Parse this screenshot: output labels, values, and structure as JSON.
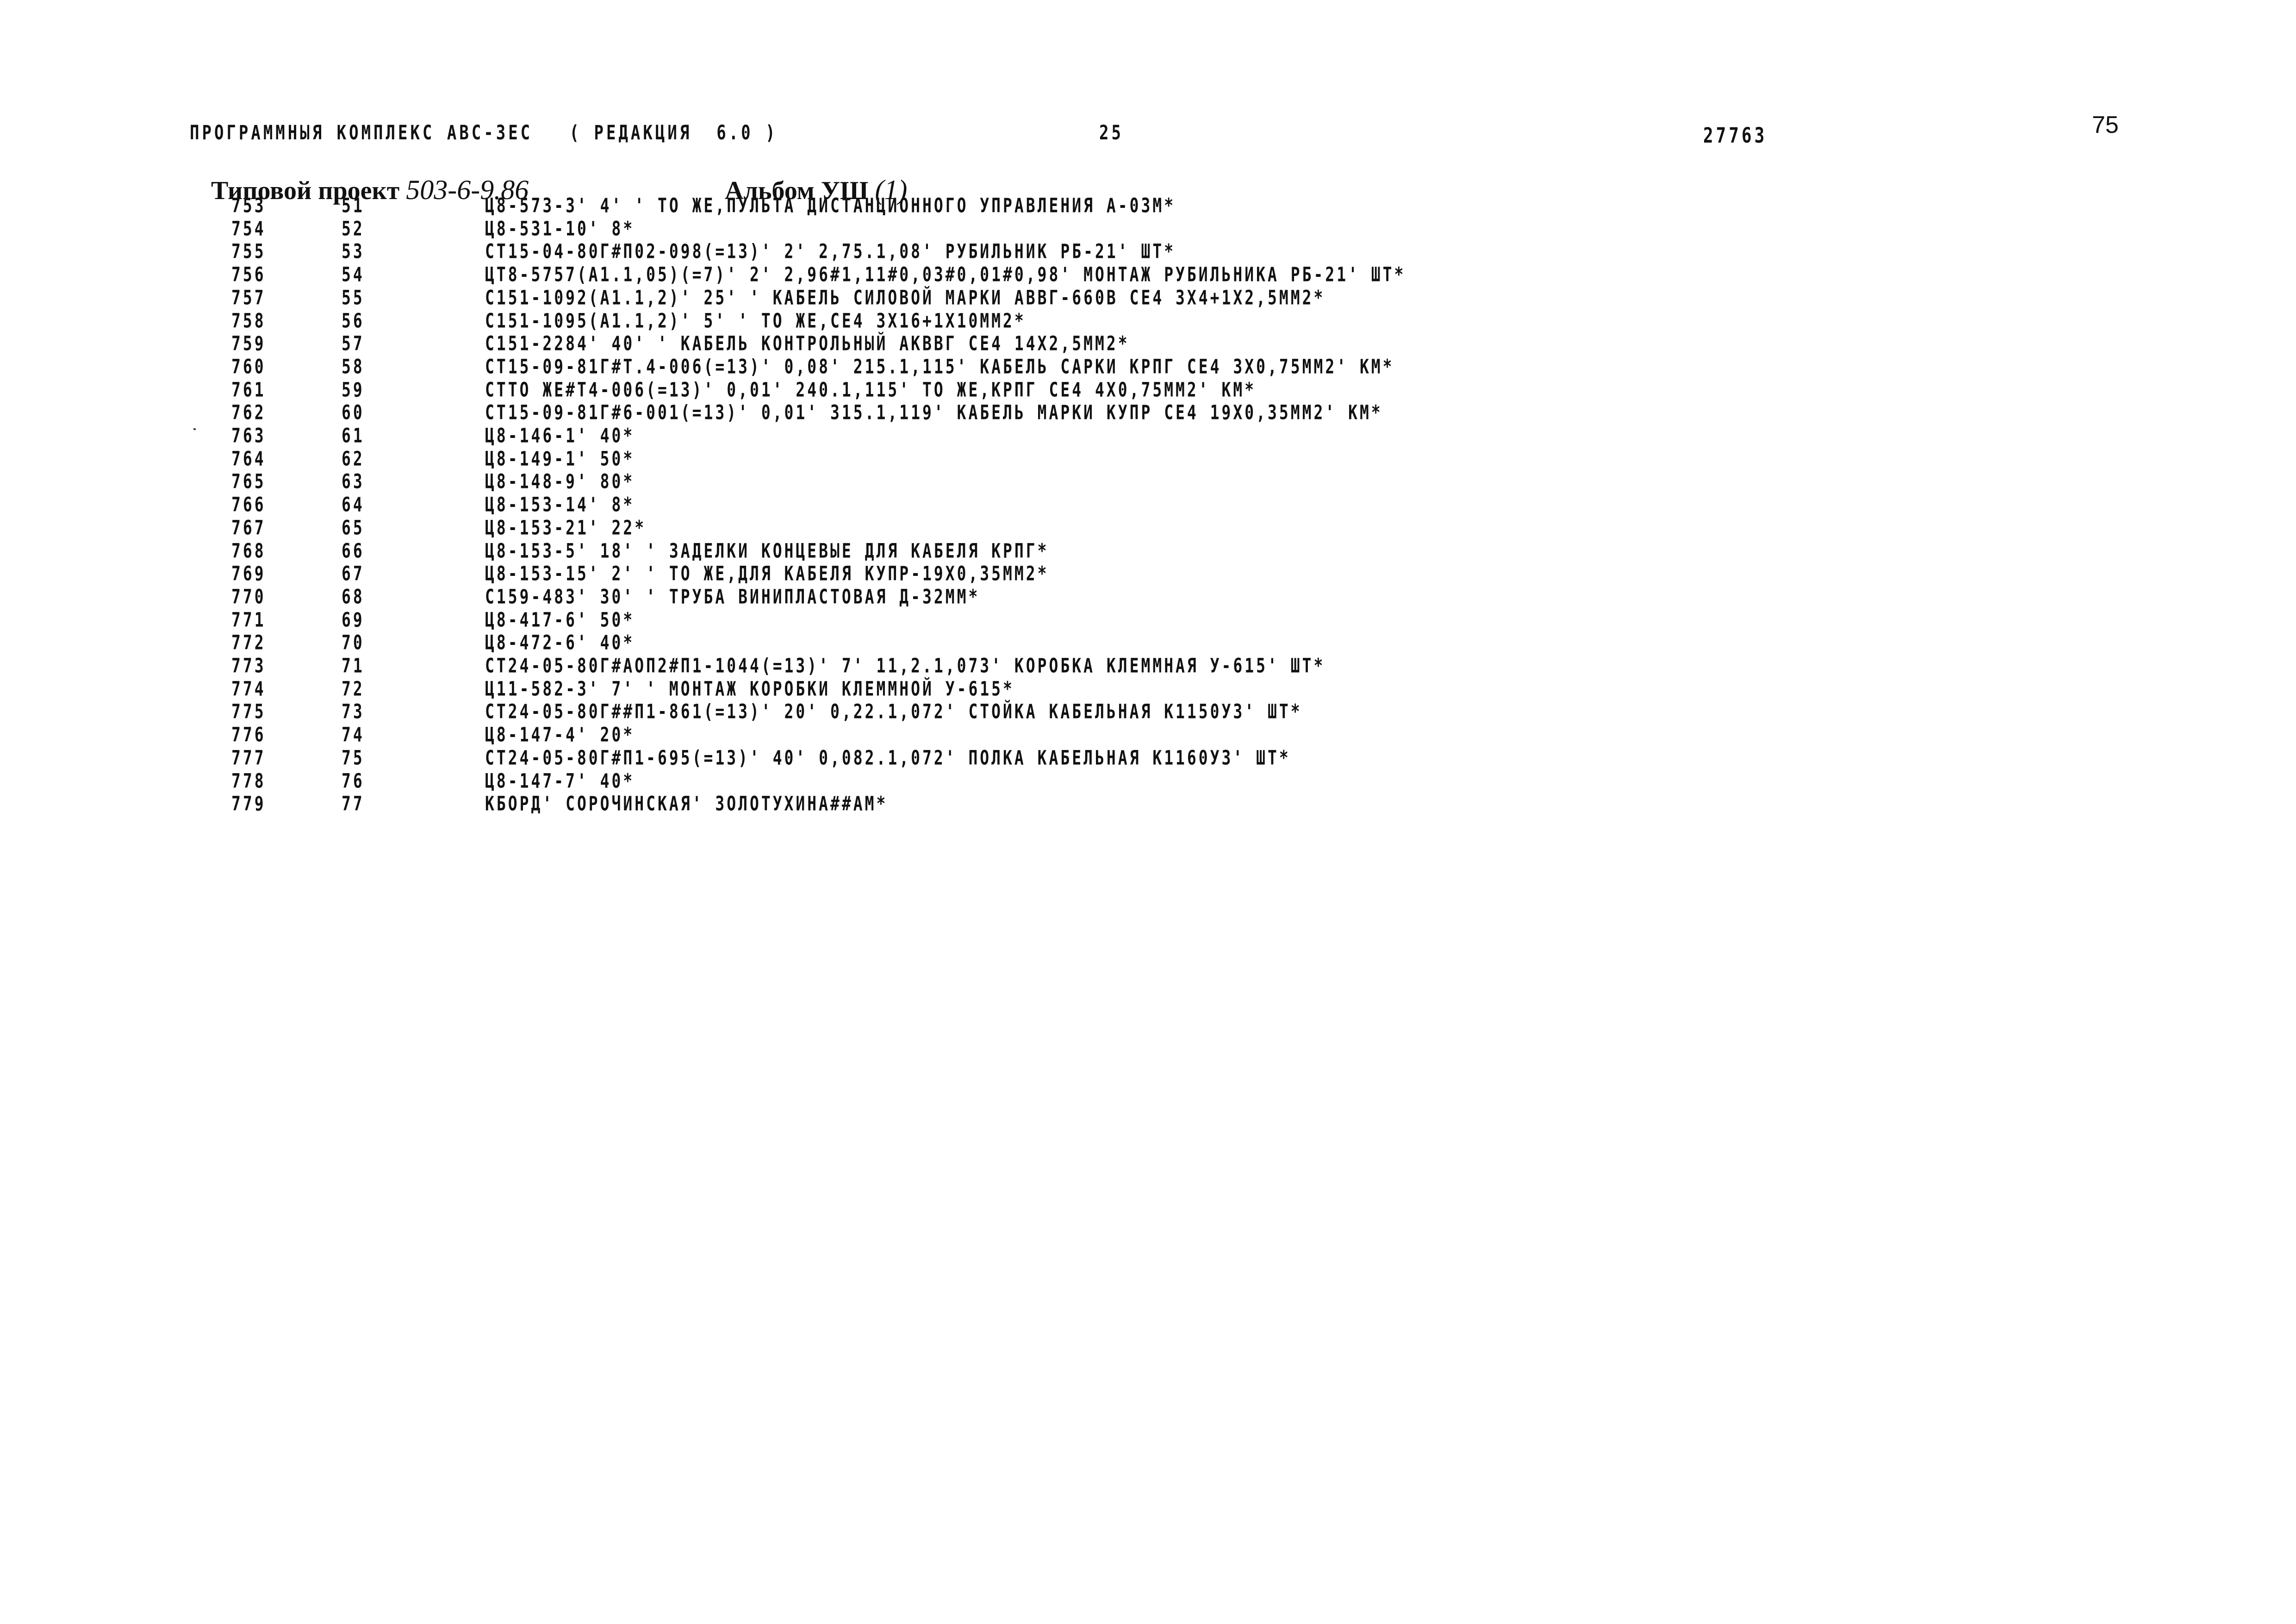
{
  "header": {
    "program": "ПРОГРАММНЫЯ КОМПЛЕКС АВС-3ЕС   ( РЕДАКЦИЯ  6.0 )",
    "page": "25",
    "doc_number": "27763",
    "sheet_number": "75"
  },
  "title": {
    "project_label": "Типовой проект ",
    "project_code": "503-6-9.86",
    "album_label": "Альбом УШ ",
    "album_part": "(1)"
  },
  "rows": [
    {
      "num": "753",
      "pos": "51",
      "text": "Ц8-573-3' 4' ' ТО ЖЕ,ПУЛЬТА ДИСТАНЦИОННОГО УПРАВЛЕНИЯ А-03М*"
    },
    {
      "num": "754",
      "pos": "52",
      "text": "Ц8-531-10' 8*"
    },
    {
      "num": "755",
      "pos": "53",
      "text": "СТ15-04-80Г#П02-098(=13)' 2' 2,75.1,08' РУБИЛЬНИК РБ-21' ШТ*"
    },
    {
      "num": "756",
      "pos": "54",
      "text": "ЦТ8-5757(А1.1,05)(=7)' 2' 2,96#1,11#0,03#0,01#0,98' МОНТАЖ РУБИЛЬНИКА РБ-21' ШТ*"
    },
    {
      "num": "757",
      "pos": "55",
      "text": "С151-1092(А1.1,2)' 25' ' КАБЕЛЬ СИЛОВОЙ МАРКИ АВВГ-660В СЕ4 3Х4+1Х2,5ММ2*"
    },
    {
      "num": "758",
      "pos": "56",
      "text": "С151-1095(А1.1,2)' 5' ' ТО ЖЕ,СЕ4 3Х16+1Х10ММ2*"
    },
    {
      "num": "759",
      "pos": "57",
      "text": "С151-2284' 40' ' КАБЕЛЬ КОНТРОЛЬНЫЙ АКВВГ СЕ4 14Х2,5ММ2*"
    },
    {
      "num": "760",
      "pos": "58",
      "text": "СТ15-09-81Г#Т.4-006(=13)' 0,08' 215.1,115' КАБЕЛЬ САРКИ КРПГ СЕ4 3Х0,75ММ2' КМ*"
    },
    {
      "num": "761",
      "pos": "59",
      "text": "СТТО ЖЕ#Т4-006(=13)' 0,01' 240.1,115' ТО ЖЕ,КРПГ СЕ4 4Х0,75ММ2' КМ*"
    },
    {
      "num": "762",
      "pos": "60",
      "text": "СТ15-09-81Г#6-001(=13)' 0,01' 315.1,119' КАБЕЛЬ МАРКИ КУПР СЕ4 19Х0,35ММ2' КМ*"
    },
    {
      "num": "763",
      "pos": "61",
      "text": "Ц8-146-1' 40*"
    },
    {
      "num": "764",
      "pos": "62",
      "text": "Ц8-149-1' 50*"
    },
    {
      "num": "765",
      "pos": "63",
      "text": "Ц8-148-9' 80*"
    },
    {
      "num": "766",
      "pos": "64",
      "text": "Ц8-153-14' 8*"
    },
    {
      "num": "767",
      "pos": "65",
      "text": "Ц8-153-21' 22*"
    },
    {
      "num": "768",
      "pos": "66",
      "text": "Ц8-153-5' 18' ' ЗАДЕЛКИ КОНЦЕВЫЕ ДЛЯ КАБЕЛЯ КРПГ*"
    },
    {
      "num": "769",
      "pos": "67",
      "text": "Ц8-153-15' 2' ' ТО ЖЕ,ДЛЯ КАБЕЛЯ КУПР-19Х0,35ММ2*"
    },
    {
      "num": "770",
      "pos": "68",
      "text": "С159-483' 30' ' ТРУБА ВИНИПЛАСТОВАЯ Д-32ММ*"
    },
    {
      "num": "771",
      "pos": "69",
      "text": "Ц8-417-6' 50*"
    },
    {
      "num": "772",
      "pos": "70",
      "text": "Ц8-472-6' 40*"
    },
    {
      "num": "773",
      "pos": "71",
      "text": "СТ24-05-80Г#АОП2#П1-1044(=13)' 7' 11,2.1,073' КОРОБКА КЛЕММНАЯ У-615' ШТ*"
    },
    {
      "num": "774",
      "pos": "72",
      "text": "Ц11-582-3' 7' ' МОНТАЖ КОРОБКИ КЛЕММНОЙ У-615*"
    },
    {
      "num": "775",
      "pos": "73",
      "text": "СТ24-05-80Г##П1-861(=13)' 20' 0,22.1,072' СТОЙКА КАБЕЛЬНАЯ К1150У3' ШТ*"
    },
    {
      "num": "776",
      "pos": "74",
      "text": "Ц8-147-4' 20*"
    },
    {
      "num": "777",
      "pos": "75",
      "text": "СТ24-05-80Г#П1-695(=13)' 40' 0,082.1,072' ПОЛКА КАБЕЛЬНАЯ К1160У3' ШТ*"
    },
    {
      "num": "778",
      "pos": "76",
      "text": "Ц8-147-7' 40*"
    },
    {
      "num": "779",
      "pos": "77",
      "text": "КБОРД' СОРОЧИНСКАЯ' ЗОЛОТУХИНА##АМ*"
    }
  ]
}
